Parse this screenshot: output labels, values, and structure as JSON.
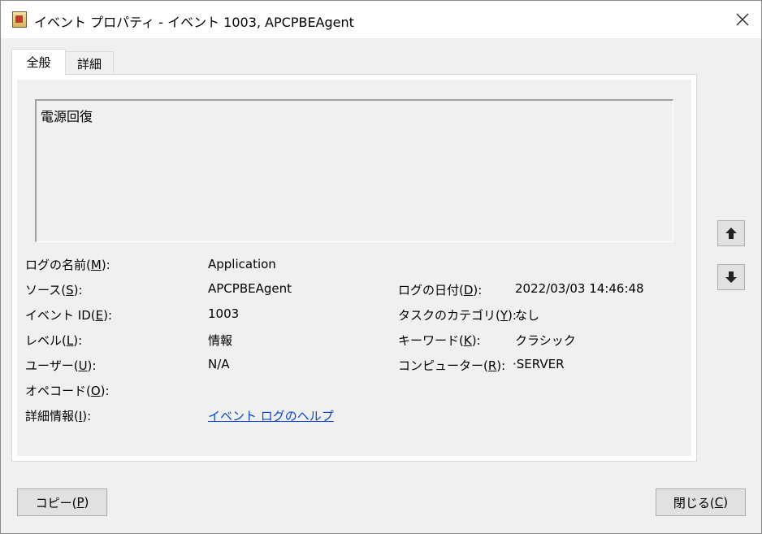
{
  "window": {
    "title": "イベント プロパティ - イベント 1003, APCPBEAgent",
    "close_icon": "close-icon"
  },
  "tabs": [
    {
      "label": "全般",
      "selected": true
    },
    {
      "label": "詳細",
      "selected": false
    }
  ],
  "description": "電源回復",
  "fields": {
    "log_name": {
      "label_pre": "ログの名前(",
      "accel": "M",
      "label_post": "):",
      "value": "Application"
    },
    "source": {
      "label_pre": "ソース(",
      "accel": "S",
      "label_post": "):",
      "value": "APCPBEAgent"
    },
    "event_id": {
      "label_pre": "イベント ID(",
      "accel": "E",
      "label_post": "):",
      "value": "1003"
    },
    "level": {
      "label_pre": "レベル(",
      "accel": "L",
      "label_post": "):",
      "value": "情報"
    },
    "user": {
      "label_pre": "ユーザー(",
      "accel": "U",
      "label_post": "):",
      "value": "N/A"
    },
    "opcode": {
      "label_pre": "オペコード(",
      "accel": "O",
      "label_post": "):",
      "value": ""
    },
    "more_info": {
      "label_pre": "詳細情報(",
      "accel": "I",
      "label_post": "):",
      "value": "イベント ログのヘルプ"
    },
    "logged": {
      "label_pre": "ログの日付(",
      "accel": "D",
      "label_post": "):",
      "value": "2022/03/03 14:46:48"
    },
    "task_category": {
      "label_pre": "タスクのカテゴリ(",
      "accel": "Y",
      "label_post": "):",
      "value": "なし"
    },
    "keywords": {
      "label_pre": "キーワード(",
      "accel": "K",
      "label_post": "):",
      "value": "クラシック"
    },
    "computer": {
      "label_pre": "コンピューター(",
      "accel": "R",
      "label_post": "):",
      "value": "·SERVER"
    }
  },
  "buttons": {
    "copy": {
      "pre": "コピー(",
      "accel": "P",
      "post": ")"
    },
    "close": {
      "pre": "閉じる(",
      "accel": "C",
      "post": ")"
    }
  }
}
